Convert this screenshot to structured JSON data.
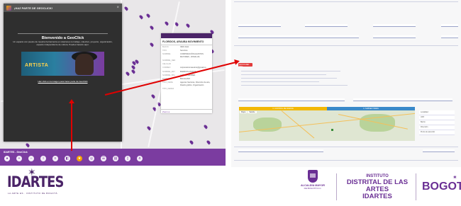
{
  "modal": {
    "title": "¡HAZ PARTE DE GEOCLICK!",
    "welcome": "Bienvenido a GeoClick",
    "description": "Un espacio con puesto de nuestra herramienta en relaciones tu trabajo, colectivo, proyecto, organización, espacio independiente de cultura. Puedes hacerlo aquí.",
    "banner_text": "ARTISTA",
    "link_text": "Haz click en la imagen para hacer parte de GeoClick",
    "close": "×"
  },
  "info_panel": {
    "title": "FLORIDOS, ARAUBA MOVIMIENTO",
    "rows": [
      {
        "k": "BLOCK",
        "v": "INFO ANA"
      },
      {
        "k": "TIPO",
        "v": "Servicios"
      },
      {
        "k": "NOMBRE",
        "v": "CORPORACIÓN AGUSTOS MAYORES - ZONALIJA"
      },
      {
        "k": "NOMBRE_RED",
        "v": ""
      },
      {
        "k": "CELULAR",
        "v": ""
      },
      {
        "k": "CORREO",
        "v": "corporacionmaestros@gmail.co"
      },
      {
        "k": "NOMBRE_EST",
        "v": "BARRIOS UNIDOS"
      },
      {
        "k": "NOMBRE_BTA",
        "v": "LOS ALCAZARES"
      },
      {
        "k": "BARRIO",
        "v": "BACALANO"
      },
      {
        "k": "TIPO_DERE",
        "v": "Agentes Sectores, Dirección de arte, Diseño gráfico, Organización"
      },
      {
        "k": "TIPO_DERE2",
        "v": ""
      }
    ],
    "footer": "Zoom a"
  },
  "map_footer": {
    "label": "IDARTES - GeoClick"
  },
  "form": {
    "badge": "DATOS RED RED",
    "tabs": [
      "3. CONTROL DE AVANCE",
      "3. SUBSECTORES"
    ],
    "map_tabs": [
      "Mapa",
      "Satélite"
    ],
    "side_items": [
      "Localidad",
      "UPZ",
      "Barrio",
      "Dirección",
      "Punto de atención"
    ]
  },
  "logos": {
    "idartes": "IDARTES",
    "idartes_tagline": "LA ARTE ES · INSTITUTO DE BOGOTÁ",
    "alcaldia_line1": "ALCALDÍA MAYOR",
    "alcaldia_line2": "DE BOGOTÁ D.C.",
    "instituto": "INSTITUTO",
    "distrital": "DISTRITAL DE LAS ARTES",
    "idartes_caps": "IDARTES",
    "bogota": "BOGOTÁ"
  }
}
